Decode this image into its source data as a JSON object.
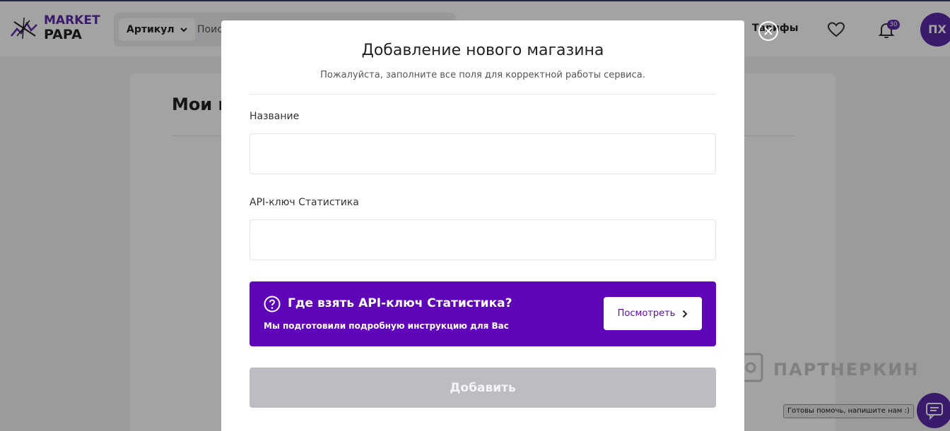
{
  "header": {
    "logo_line1": "MARKET",
    "logo_line2": "PAPA",
    "search": {
      "type_label": "Артикул",
      "placeholder": "Поиск"
    },
    "tariffs_label": "Тарифы",
    "notifications_count": "30",
    "avatar_initials": "ПХ"
  },
  "page": {
    "title": "Мои магазины"
  },
  "modal": {
    "title": "Добавление нового магазина",
    "subtitle": "Пожалуйста, заполните все поля для корректной работы сервиса.",
    "fields": [
      {
        "label": "Название",
        "value": ""
      },
      {
        "label": "API-ключ Статистика",
        "value": ""
      }
    ],
    "info": {
      "title": "Где взять API-ключ Статистика?",
      "subtitle": "Мы подготовили подробную инструкцию для Вас",
      "button_label": "Посмотреть"
    },
    "submit_label": "Добавить"
  },
  "watermark": "ПАРТНЕРКИН",
  "chat": {
    "tooltip": "Готовы помочь, напишите нам :)"
  },
  "colors": {
    "brand": "#5c2aa8",
    "banner": "#5e06b8",
    "submit_disabled": "#bcbcc2"
  }
}
